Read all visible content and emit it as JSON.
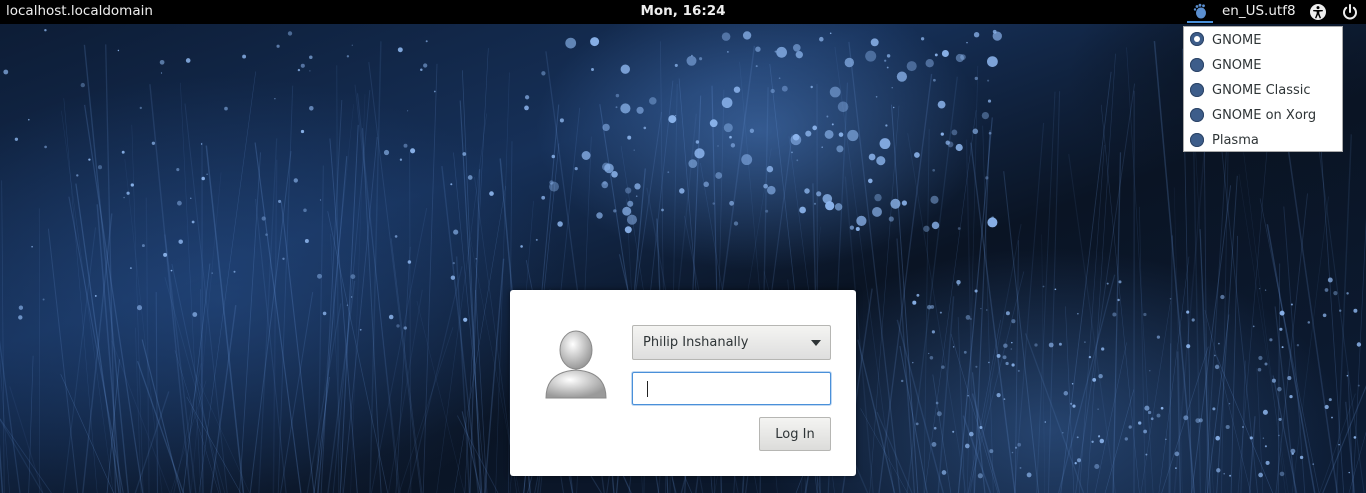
{
  "topbar": {
    "hostname": "localhost.localdomain",
    "clock": "Mon, 16:24",
    "locale": "en_US.utf8",
    "icons": {
      "session": "gnome-foot-icon",
      "accessibility": "accessibility-icon",
      "power": "power-icon"
    }
  },
  "session_menu": {
    "items": [
      {
        "label": "GNOME",
        "checked": true
      },
      {
        "label": "GNOME",
        "checked": false
      },
      {
        "label": "GNOME Classic",
        "checked": false
      },
      {
        "label": "GNOME on Xorg",
        "checked": false
      },
      {
        "label": "Plasma",
        "checked": false
      }
    ]
  },
  "login": {
    "user": "Philip Inshanally",
    "password_value": "",
    "button_label": "Log In"
  },
  "colors": {
    "accent": "#4a90d9",
    "radio": "#3d5d8a",
    "topbar": "#000000"
  }
}
